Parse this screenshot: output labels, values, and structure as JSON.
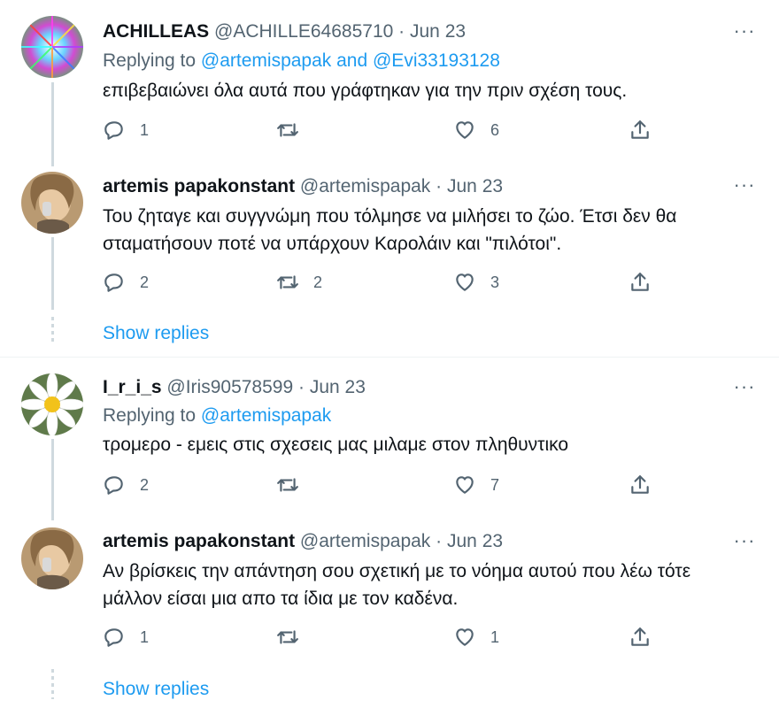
{
  "tweets": [
    {
      "name": "ACHILLEAS",
      "handle": "@ACHILLE64685710",
      "sep": "·",
      "date": "Jun 23",
      "replying_prefix": "Replying to",
      "replying_links": "@artemispapak and @Evi33193128",
      "text": "επιβεβαιώνει όλα αυτά που γράφτηκαν για την πριν σχέση τους.",
      "reply_count": "1",
      "retweet_count": "",
      "like_count": "6"
    },
    {
      "name": "artemis papakonstant",
      "handle": "@artemispapak",
      "sep": "·",
      "date": "Jun 23",
      "text_line1": "Του ζηταγε και συγγνώμη που τόλμησε να μιλήσει το ζώο. Έτσι δεν θα",
      "text_line2": "σταματήσουν ποτέ να υπάρχουν Καρολάιν και \"πιλότοι\".",
      "reply_count": "2",
      "retweet_count": "2",
      "like_count": "3"
    },
    {
      "name": "I_r_i_s",
      "handle": "@Iris90578599",
      "sep": "·",
      "date": "Jun 23",
      "replying_prefix": "Replying to",
      "replying_links": "@artemispapak",
      "text": "τρομερο - εμεις στις σχεσεις μας μιλαμε στον πληθυντικο",
      "reply_count": "2",
      "retweet_count": "",
      "like_count": "7"
    },
    {
      "name": "artemis papakonstant",
      "handle": "@artemispapak",
      "sep": "·",
      "date": "Jun 23",
      "text_line1": "Αν βρίσκεις την απάντηση σου σχετική με το νόημα αυτού που λέω τότε",
      "text_line2": "μάλλον είσαι μια απο τα ίδια με τον καδένα.",
      "reply_count": "1",
      "retweet_count": "",
      "like_count": "1"
    }
  ],
  "show_replies_label": "Show replies",
  "more_label": "···",
  "colors": {
    "accent": "#1d9bf0",
    "muted": "#536471",
    "line": "#cfd9de"
  },
  "icons": [
    "reply-icon",
    "retweet-icon",
    "like-icon",
    "share-icon",
    "more-icon"
  ]
}
